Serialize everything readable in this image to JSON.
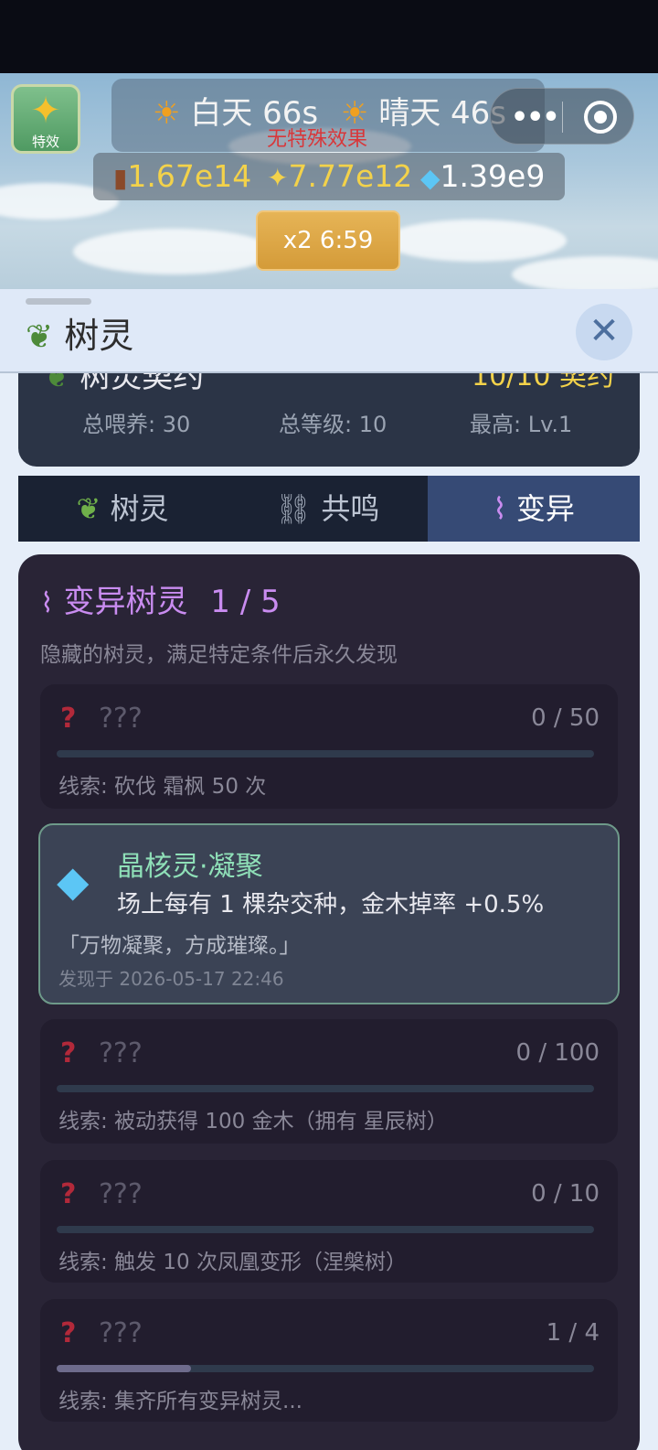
{
  "header_bar": {
    "fx_label": "特效",
    "weather_day": "白天 66s",
    "weather_sunny": "晴天 46s",
    "weather_effect": "无特殊效果",
    "capsule_more": "•••",
    "boost_label": "x2 6:59"
  },
  "resources": {
    "wood": "1.67e14",
    "star": "7.77e12",
    "gem": "1.39e9"
  },
  "panel": {
    "title": "树灵",
    "summary_partial_left": "树灵契约",
    "summary_partial_right": "10/10 契约",
    "stats": [
      {
        "text": "总喂养: 30"
      },
      {
        "text": "总等级: 10"
      },
      {
        "text": "最高: Lv.1"
      }
    ]
  },
  "tabs": [
    {
      "label": "树灵",
      "icon": "sprout-icon",
      "active": false
    },
    {
      "label": "共鸣",
      "icon": "link-icon",
      "active": false
    },
    {
      "label": "变异",
      "icon": "dna-icon",
      "active": true
    }
  ],
  "mutation": {
    "title": "变异树灵",
    "count": "1 / 5",
    "description": "隐藏的树灵，满足特定条件后永久发现",
    "items": [
      {
        "name": "???",
        "progress": "0 / 50",
        "fraction": 0,
        "clue": "线索: 砍伐 霜枫 50 次"
      },
      {
        "name": "???",
        "progress": "0 / 100",
        "fraction": 0,
        "clue": "线索: 被动获得 100 金木（拥有 星辰树）"
      },
      {
        "name": "???",
        "progress": "0 / 10",
        "fraction": 0,
        "clue": "线索: 触发 10 次凤凰变形（涅槃树）"
      },
      {
        "name": "???",
        "progress": "1 / 4",
        "fraction": 0.25,
        "clue": "线索: 集齐所有变异树灵..."
      }
    ],
    "found": {
      "name": "晶核灵·凝聚",
      "effect": "场上每有 1 棵杂交种，金木掉率 +0.5%",
      "quote": "「万物凝聚，方成璀璨。」",
      "date": "发现于 2026-05-17 22:46"
    }
  },
  "colors": {
    "accent_purple": "#c98cf0",
    "found_green": "#8fe0b8",
    "gold": "#f3d24a",
    "active_tab": "#364a75"
  }
}
